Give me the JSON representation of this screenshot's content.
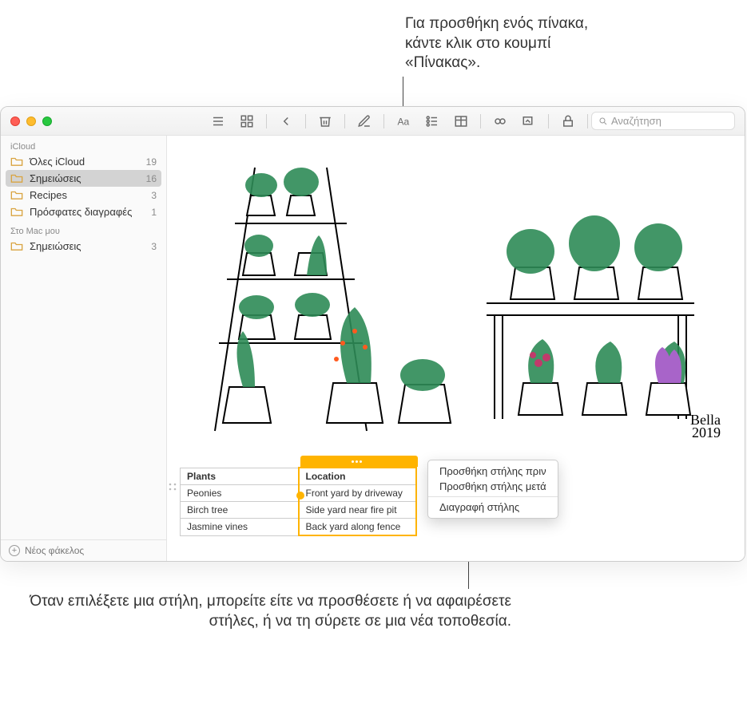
{
  "callouts": {
    "top": "Για προσθήκη ενός πίνακα, κάντε κλικ στο κουμπί «Πίνακας».",
    "bottom": "Όταν επιλέξετε μια στήλη, μπορείτε είτε να προσθέσετε ή να αφαιρέσετε στήλες, ή να τη σύρετε σε μια νέα τοποθεσία."
  },
  "search": {
    "placeholder": "Αναζήτηση"
  },
  "sidebar": {
    "sections": {
      "icloud_label": "iCloud",
      "local_label": "Στο Mac μου"
    },
    "icloud": [
      {
        "label": "Όλες iCloud",
        "count": "19"
      },
      {
        "label": "Σημειώσεις",
        "count": "16"
      },
      {
        "label": "Recipes",
        "count": "3"
      },
      {
        "label": "Πρόσφατες διαγραφές",
        "count": "1"
      }
    ],
    "local": [
      {
        "label": "Σημειώσεις",
        "count": "3"
      }
    ],
    "new_folder_label": "Νέος φάκελος"
  },
  "signature": {
    "name": "Bella",
    "year": "2019"
  },
  "table": {
    "headers": [
      "Plants",
      "Location"
    ],
    "rows": [
      [
        "Peonies",
        "Front yard by driveway"
      ],
      [
        "Birch tree",
        "Side yard near fire pit"
      ],
      [
        "Jasmine vines",
        "Back yard along fence"
      ]
    ]
  },
  "context_menu": {
    "add_before": "Προσθήκη στήλης πριν",
    "add_after": "Προσθήκη στήλης μετά",
    "delete": "Διαγραφή στήλης"
  }
}
